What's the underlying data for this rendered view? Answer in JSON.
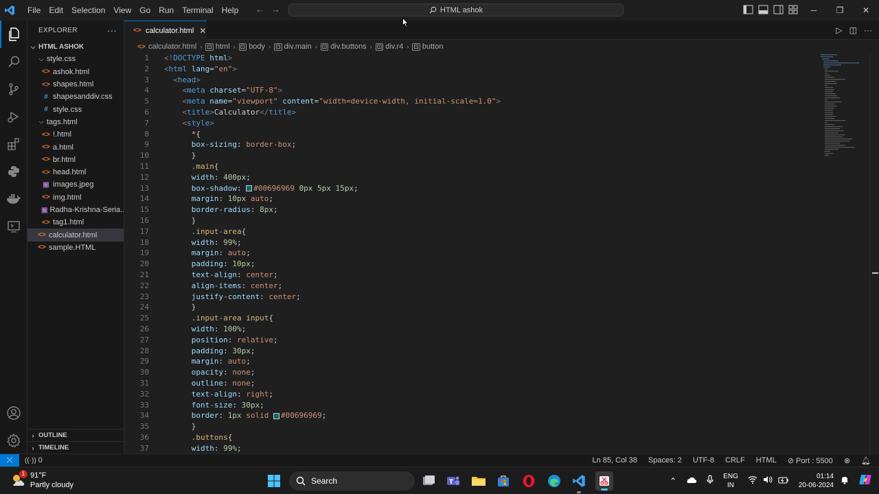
{
  "titlebar": {
    "menu": [
      "File",
      "Edit",
      "Selection",
      "View",
      "Go",
      "Run",
      "Terminal",
      "Help"
    ],
    "search_label": "HTML ashok"
  },
  "sidebar": {
    "title": "EXPLORER",
    "root": "HTML ASHOK",
    "items": [
      {
        "label": "style.css",
        "kind": "folder",
        "indent": 1
      },
      {
        "label": "ashok.html",
        "kind": "html",
        "indent": 2
      },
      {
        "label": "shapes.html",
        "kind": "html",
        "indent": 2
      },
      {
        "label": "shapesanddiv.css",
        "kind": "css",
        "indent": 2
      },
      {
        "label": "style.css",
        "kind": "css",
        "indent": 2
      },
      {
        "label": "tags.html",
        "kind": "folder",
        "indent": 1
      },
      {
        "label": "!.html",
        "kind": "html",
        "indent": 2
      },
      {
        "label": "a.html",
        "kind": "html",
        "indent": 2
      },
      {
        "label": "br.html",
        "kind": "html",
        "indent": 2
      },
      {
        "label": "head.html",
        "kind": "html",
        "indent": 2
      },
      {
        "label": "images.jpeg",
        "kind": "img",
        "indent": 2
      },
      {
        "label": "img.html",
        "kind": "html",
        "indent": 2
      },
      {
        "label": "Radha-Krishna-Seria...",
        "kind": "img",
        "indent": 2
      },
      {
        "label": "tag1.html",
        "kind": "html",
        "indent": 2
      },
      {
        "label": "calculator.html",
        "kind": "html",
        "indent": 1,
        "selected": true
      },
      {
        "label": "sample.HTML",
        "kind": "html",
        "indent": 1
      }
    ],
    "outline": "OUTLINE",
    "timeline": "TIMELINE"
  },
  "tab": {
    "label": "calculator.html"
  },
  "breadcrumb": [
    "calculator.html",
    "html",
    "body",
    "div.main",
    "div.buttons",
    "div.r4",
    "button"
  ],
  "code_lines": [
    [
      [
        "t-punct",
        "<!"
      ],
      [
        "t-tag",
        "DOCTYPE"
      ],
      [
        "t-txt",
        " "
      ],
      [
        "t-attr",
        "html"
      ],
      [
        "t-punct",
        ">"
      ]
    ],
    [
      [
        "t-punct",
        "<"
      ],
      [
        "t-tag",
        "html"
      ],
      [
        "t-txt",
        " "
      ],
      [
        "t-attr",
        "lang"
      ],
      [
        "t-txt",
        "="
      ],
      [
        "t-str",
        "\"en\""
      ],
      [
        "t-punct",
        ">"
      ]
    ],
    [
      [
        "t-txt",
        "  "
      ],
      [
        "t-punct",
        "<"
      ],
      [
        "t-tag",
        "head"
      ],
      [
        "t-punct",
        ">"
      ]
    ],
    [
      [
        "t-txt",
        "    "
      ],
      [
        "t-punct",
        "<"
      ],
      [
        "t-tag",
        "meta"
      ],
      [
        "t-txt",
        " "
      ],
      [
        "t-attr",
        "charset"
      ],
      [
        "t-txt",
        "="
      ],
      [
        "t-str",
        "\"UTF-8\""
      ],
      [
        "t-punct",
        ">"
      ]
    ],
    [
      [
        "t-txt",
        "    "
      ],
      [
        "t-punct",
        "<"
      ],
      [
        "t-tag",
        "meta"
      ],
      [
        "t-txt",
        " "
      ],
      [
        "t-attr",
        "name"
      ],
      [
        "t-txt",
        "="
      ],
      [
        "t-str",
        "\"viewport\""
      ],
      [
        "t-txt",
        " "
      ],
      [
        "t-attr",
        "content"
      ],
      [
        "t-txt",
        "="
      ],
      [
        "t-str",
        "\"width=device-width, initial-scale=1.0\""
      ],
      [
        "t-punct",
        ">"
      ]
    ],
    [
      [
        "t-txt",
        "    "
      ],
      [
        "t-punct",
        "<"
      ],
      [
        "t-tag",
        "title"
      ],
      [
        "t-punct",
        ">"
      ],
      [
        "t-txt",
        "Calculator"
      ],
      [
        "t-punct",
        "</"
      ],
      [
        "t-tag",
        "title"
      ],
      [
        "t-punct",
        ">"
      ]
    ],
    [
      [
        "t-txt",
        "    "
      ],
      [
        "t-punct",
        "<"
      ],
      [
        "t-tag",
        "style"
      ],
      [
        "t-punct",
        ">"
      ]
    ],
    [
      [
        "t-txt",
        "      "
      ],
      [
        "t-sel",
        "*"
      ],
      [
        "t-txt",
        "{"
      ]
    ],
    [
      [
        "t-txt",
        "      "
      ],
      [
        "t-prop",
        "box-sizing"
      ],
      [
        "t-txt",
        ": "
      ],
      [
        "t-str",
        "border-box"
      ],
      [
        "t-txt",
        ";"
      ]
    ],
    [
      [
        "t-txt",
        "      }"
      ]
    ],
    [
      [
        "t-txt",
        "      "
      ],
      [
        "t-sel",
        ".main"
      ],
      [
        "t-txt",
        "{"
      ]
    ],
    [
      [
        "t-txt",
        "      "
      ],
      [
        "t-prop",
        "width"
      ],
      [
        "t-txt",
        ": "
      ],
      [
        "t-num",
        "400px"
      ],
      [
        "t-txt",
        ";"
      ]
    ],
    [
      [
        "t-txt",
        "      "
      ],
      [
        "t-prop",
        "box-shadow"
      ],
      [
        "t-txt",
        ": "
      ],
      [
        "swatch",
        ""
      ],
      [
        "t-str",
        "#00696969"
      ],
      [
        "t-txt",
        " "
      ],
      [
        "t-num",
        "0px 5px 15px"
      ],
      [
        "t-txt",
        ";"
      ]
    ],
    [
      [
        "t-txt",
        "      "
      ],
      [
        "t-prop",
        "margin"
      ],
      [
        "t-txt",
        ": "
      ],
      [
        "t-num",
        "10px"
      ],
      [
        "t-txt",
        " "
      ],
      [
        "t-str",
        "auto"
      ],
      [
        "t-txt",
        ";"
      ]
    ],
    [
      [
        "t-txt",
        "      "
      ],
      [
        "t-prop",
        "border-radius"
      ],
      [
        "t-txt",
        ": "
      ],
      [
        "t-num",
        "8px"
      ],
      [
        "t-txt",
        ";"
      ]
    ],
    [
      [
        "t-txt",
        "      }"
      ]
    ],
    [
      [
        "t-txt",
        "      "
      ],
      [
        "t-sel",
        ".input-area"
      ],
      [
        "t-txt",
        "{"
      ]
    ],
    [
      [
        "t-txt",
        "      "
      ],
      [
        "t-prop",
        "width"
      ],
      [
        "t-txt",
        ": "
      ],
      [
        "t-num",
        "99%"
      ],
      [
        "t-txt",
        ";"
      ]
    ],
    [
      [
        "t-txt",
        "      "
      ],
      [
        "t-prop",
        "margin"
      ],
      [
        "t-txt",
        ": "
      ],
      [
        "t-str",
        "auto"
      ],
      [
        "t-txt",
        ";"
      ]
    ],
    [
      [
        "t-txt",
        "      "
      ],
      [
        "t-prop",
        "padding"
      ],
      [
        "t-txt",
        ": "
      ],
      [
        "t-num",
        "10px"
      ],
      [
        "t-txt",
        ";"
      ]
    ],
    [
      [
        "t-txt",
        "      "
      ],
      [
        "t-prop",
        "text-align"
      ],
      [
        "t-txt",
        ": "
      ],
      [
        "t-str",
        "center"
      ],
      [
        "t-txt",
        ";"
      ]
    ],
    [
      [
        "t-txt",
        "      "
      ],
      [
        "t-prop",
        "align-items"
      ],
      [
        "t-txt",
        ": "
      ],
      [
        "t-str",
        "center"
      ],
      [
        "t-txt",
        ";"
      ]
    ],
    [
      [
        "t-txt",
        "      "
      ],
      [
        "t-prop",
        "justify-content"
      ],
      [
        "t-txt",
        ": "
      ],
      [
        "t-str",
        "center"
      ],
      [
        "t-txt",
        ";"
      ]
    ],
    [
      [
        "t-txt",
        "      }"
      ]
    ],
    [
      [
        "t-txt",
        "      "
      ],
      [
        "t-sel",
        ".input-area input"
      ],
      [
        "t-txt",
        "{"
      ]
    ],
    [
      [
        "t-txt",
        "      "
      ],
      [
        "t-prop",
        "width"
      ],
      [
        "t-txt",
        ": "
      ],
      [
        "t-num",
        "100%"
      ],
      [
        "t-txt",
        ";"
      ]
    ],
    [
      [
        "t-txt",
        "      "
      ],
      [
        "t-prop",
        "position"
      ],
      [
        "t-txt",
        ": "
      ],
      [
        "t-str",
        "relative"
      ],
      [
        "t-txt",
        ";"
      ]
    ],
    [
      [
        "t-txt",
        "      "
      ],
      [
        "t-prop",
        "padding"
      ],
      [
        "t-txt",
        ": "
      ],
      [
        "t-num",
        "30px"
      ],
      [
        "t-txt",
        ";"
      ]
    ],
    [
      [
        "t-txt",
        "      "
      ],
      [
        "t-prop",
        "margin"
      ],
      [
        "t-txt",
        ": "
      ],
      [
        "t-str",
        "auto"
      ],
      [
        "t-txt",
        ";"
      ]
    ],
    [
      [
        "t-txt",
        "      "
      ],
      [
        "t-prop",
        "opacity"
      ],
      [
        "t-txt",
        ": "
      ],
      [
        "t-str",
        "none"
      ],
      [
        "t-txt",
        ";"
      ]
    ],
    [
      [
        "t-txt",
        "      "
      ],
      [
        "t-prop",
        "outline"
      ],
      [
        "t-txt",
        ": "
      ],
      [
        "t-str",
        "none"
      ],
      [
        "t-txt",
        ";"
      ]
    ],
    [
      [
        "t-txt",
        "      "
      ],
      [
        "t-prop",
        "text-align"
      ],
      [
        "t-txt",
        ": "
      ],
      [
        "t-str",
        "right"
      ],
      [
        "t-txt",
        ";"
      ]
    ],
    [
      [
        "t-txt",
        "      "
      ],
      [
        "t-prop",
        "font-size"
      ],
      [
        "t-txt",
        ": "
      ],
      [
        "t-num",
        "30px"
      ],
      [
        "t-txt",
        ";"
      ]
    ],
    [
      [
        "t-txt",
        "      "
      ],
      [
        "t-prop",
        "border"
      ],
      [
        "t-txt",
        ": "
      ],
      [
        "t-num",
        "1px"
      ],
      [
        "t-txt",
        " "
      ],
      [
        "t-str",
        "solid"
      ],
      [
        "t-txt",
        " "
      ],
      [
        "swatch",
        ""
      ],
      [
        "t-str",
        "#00696969"
      ],
      [
        "t-txt",
        ";"
      ]
    ],
    [
      [
        "t-txt",
        "      }"
      ]
    ],
    [
      [
        "t-txt",
        "      "
      ],
      [
        "t-sel",
        ".buttons"
      ],
      [
        "t-txt",
        "{"
      ]
    ],
    [
      [
        "t-txt",
        "      "
      ],
      [
        "t-prop",
        "width"
      ],
      [
        "t-txt",
        ": "
      ],
      [
        "t-num",
        "99%"
      ],
      [
        "t-txt",
        ";"
      ]
    ]
  ],
  "statusbar": {
    "problems": "0",
    "position": "Ln 85, Col 38",
    "spaces": "Spaces: 2",
    "encoding": "UTF-8",
    "eol": "CRLF",
    "language": "HTML",
    "port": "Port : 5500"
  },
  "taskbar": {
    "weather_temp": "91°F",
    "weather_desc": "Partly cloudy",
    "weather_badge": "1",
    "search_label": "Search",
    "lang_top": "ENG",
    "lang_bottom": "IN",
    "time": "01:14",
    "date": "20-06-2024"
  },
  "colors": {
    "accent": "#0078d4",
    "editor_bg": "#1f1f1f",
    "sidebar_bg": "#181818"
  }
}
